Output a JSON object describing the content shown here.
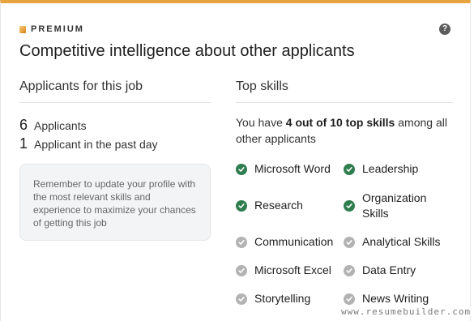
{
  "header": {
    "badge": "PREMIUM",
    "help_icon": "question-circle-icon",
    "help_glyph": "?",
    "title": "Competitive intelligence about other applicants"
  },
  "applicants": {
    "heading": "Applicants for this job",
    "total_count": "6",
    "total_label": "Applicants",
    "recent_count": "1",
    "recent_label": "Applicant in the past day",
    "tip": "Remember to update your profile with the most relevant skills and experience to maximize your chances of getting this job"
  },
  "skills": {
    "heading": "Top skills",
    "summary_prefix": "You have ",
    "summary_bold": "4 out of 10 top skills",
    "summary_suffix": " among all other applicants",
    "items": [
      {
        "label": "Microsoft Word",
        "matched": true
      },
      {
        "label": "Leadership",
        "matched": true
      },
      {
        "label": "Research",
        "matched": true
      },
      {
        "label": "Organization Skills",
        "matched": true
      },
      {
        "label": "Communication",
        "matched": false
      },
      {
        "label": "Analytical Skills",
        "matched": false
      },
      {
        "label": "Microsoft Excel",
        "matched": false
      },
      {
        "label": "Data Entry",
        "matched": false
      },
      {
        "label": "Storytelling",
        "matched": false
      },
      {
        "label": "News Writing",
        "matched": false
      }
    ]
  },
  "watermark": "www.resumebuilder.com",
  "colors": {
    "accent": "#e7a33e",
    "matched": "#2e7d4f",
    "unmatched": "#b3b3b3"
  }
}
